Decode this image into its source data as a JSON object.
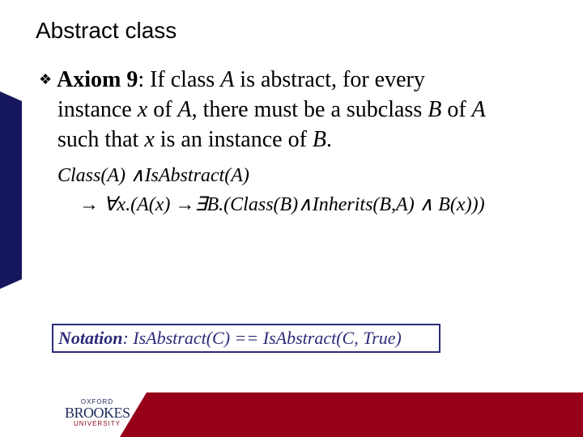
{
  "slide": {
    "title": "Abstract class",
    "bullet": {
      "icon": "diamond-bullet-icon",
      "glyph": "❖",
      "label_bold": "Axiom 9",
      "lines": [
        {
          "parts": [
            ": If class ",
            "A",
            " is abstract, for every"
          ]
        },
        {
          "parts": [
            "instance ",
            "x",
            " of ",
            "A",
            ", there must be a subclass ",
            "B",
            " of ",
            "A"
          ]
        },
        {
          "parts": [
            "such that  ",
            "x",
            " is an instance of ",
            "B",
            "."
          ]
        }
      ]
    },
    "formula": {
      "line1": "Class(A) ∧IsAbstract(A)",
      "line2": "→ ∀x.(A(x) →∃B.(Class(B)∧Inherits(B,A) ∧ B(x)))"
    },
    "notation": {
      "label": "Notation",
      "text": ": IsAbstract(C) == IsAbstract(C, True)"
    },
    "logo": {
      "line1": "OXFORD",
      "line2": "BROOKES",
      "line3": "UNIVERSITY"
    },
    "colors": {
      "navy": "#17175e",
      "crimson": "#960019",
      "notation_border": "#2c2c7a"
    }
  }
}
